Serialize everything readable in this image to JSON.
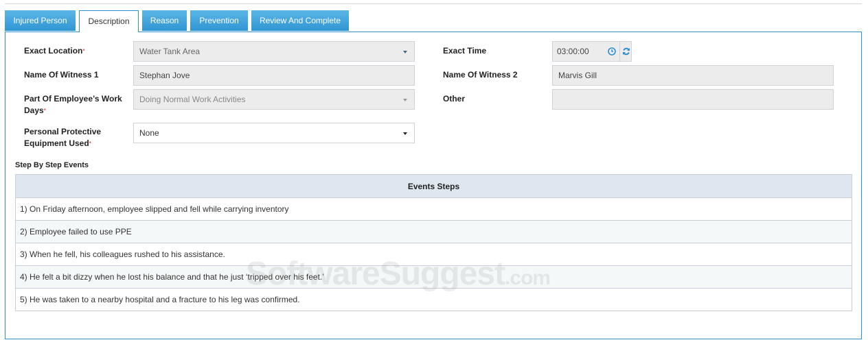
{
  "tabs": [
    {
      "label": "Injured Person",
      "active": false
    },
    {
      "label": "Description",
      "active": true
    },
    {
      "label": "Reason",
      "active": false
    },
    {
      "label": "Prevention",
      "active": false
    },
    {
      "label": "Review And Complete",
      "active": false
    }
  ],
  "form": {
    "exact_location": {
      "label": "Exact Location",
      "required": "*",
      "value": "Water Tank Area"
    },
    "witness1": {
      "label": "Name Of Witness 1",
      "value": "Stephan Jove"
    },
    "work_days": {
      "label1": "Part Of Employee’s Work",
      "label2": "Days",
      "required": "*",
      "value": "Doing Normal Work Activities"
    },
    "ppe": {
      "label1": "Personal Protective",
      "label2": "Equipment Used",
      "required": "*",
      "value": "None"
    },
    "exact_time": {
      "label": "Exact Time",
      "value": "03:00:00"
    },
    "witness2": {
      "label": "Name Of Witness 2",
      "value": "Marvis Gill"
    },
    "other": {
      "label": "Other",
      "value": ""
    }
  },
  "events": {
    "section_title": "Step By Step Events",
    "column": "Events Steps",
    "rows": [
      "1) On Friday afternoon, employee slipped and fell while carrying inventory",
      "2) Employee failed to use PPE",
      "3) When he fell, his colleagues rushed to his assistance.",
      "4) He felt a bit dizzy when he lost his balance and that he just ‘tripped over his feet.’",
      "5) He was taken to a nearby hospital and a fracture to his leg was confirmed."
    ]
  },
  "watermark": {
    "main": "SoftwareSuggest",
    "suffix": ".com"
  },
  "colors": {
    "accent": "#2b8fd0",
    "tab": "#3fa3db"
  }
}
